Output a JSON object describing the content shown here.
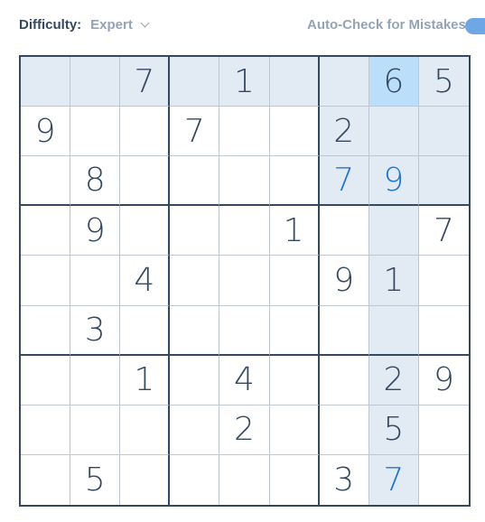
{
  "header": {
    "difficulty_label": "Difficulty:",
    "difficulty_value": "Expert",
    "autocheck_label": "Auto-Check for Mistakes",
    "autocheck_enabled": true
  },
  "board": {
    "selected": {
      "row": 0,
      "col": 7
    },
    "colors": {
      "given": "#344861",
      "user_entry": "#1a73d9",
      "highlight": "#e2ebf3",
      "selected": "#bbdefb"
    },
    "cells": [
      [
        "",
        "",
        "7",
        "",
        "1",
        "",
        "",
        "6",
        "5"
      ],
      [
        "9",
        "",
        "",
        "7",
        "",
        "",
        "2",
        "",
        ""
      ],
      [
        "",
        "8",
        "",
        "",
        "",
        "",
        "7",
        "9",
        ""
      ],
      [
        "",
        "9",
        "",
        "",
        "",
        "1",
        "",
        "",
        "7"
      ],
      [
        "",
        "",
        "4",
        "",
        "",
        "",
        "9",
        "1",
        ""
      ],
      [
        "",
        "3",
        "",
        "",
        "",
        "",
        "",
        "",
        ""
      ],
      [
        "",
        "",
        "1",
        "",
        "4",
        "",
        "",
        "2",
        "9"
      ],
      [
        "",
        "",
        "",
        "",
        "2",
        "",
        "",
        "5",
        ""
      ],
      [
        "",
        "5",
        "",
        "",
        "",
        "",
        "3",
        "7",
        ""
      ]
    ],
    "user_entries": [
      {
        "row": 2,
        "col": 6
      },
      {
        "row": 2,
        "col": 7
      },
      {
        "row": 8,
        "col": 7
      }
    ]
  }
}
